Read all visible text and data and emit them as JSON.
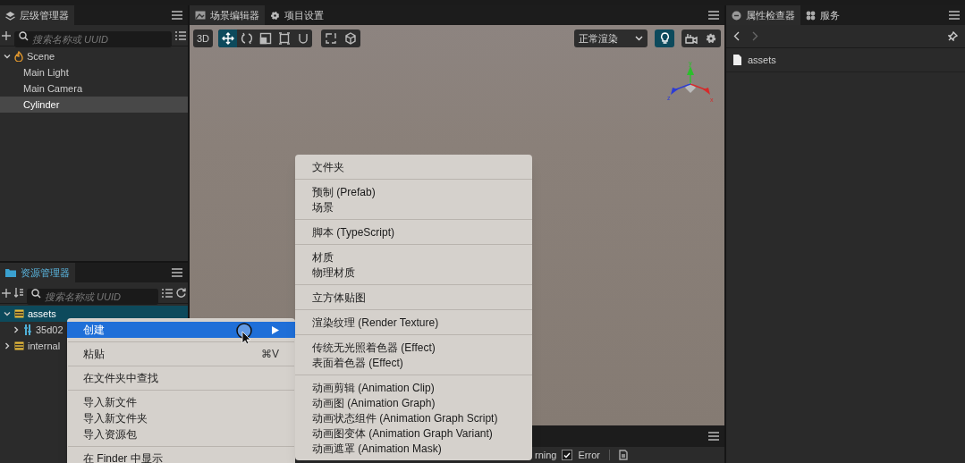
{
  "hierarchy": {
    "tab": "层级管理器",
    "search": {
      "placeholder": "搜索名称或 UUID"
    },
    "tree": [
      {
        "label": "Scene",
        "kind": "scene",
        "expanded": true,
        "selected": false,
        "children": [
          {
            "label": "Main Light",
            "selected": false
          },
          {
            "label": "Main Camera",
            "selected": false
          },
          {
            "label": "Cylinder",
            "selected": true
          }
        ]
      }
    ]
  },
  "scene_editor": {
    "tabs": [
      {
        "label": "场景编辑器",
        "kind": "image",
        "selected": true
      },
      {
        "label": "项目设置",
        "kind": "gear",
        "selected": false
      }
    ],
    "mode_button": "3D",
    "tools": [
      {
        "kind": "move",
        "selected": true
      },
      {
        "kind": "rotate",
        "selected": false
      },
      {
        "kind": "scale",
        "selected": false
      },
      {
        "kind": "rect",
        "selected": false
      },
      {
        "kind": "snap",
        "selected": false
      }
    ],
    "render_mode": "正常渲染",
    "light_on": true,
    "gizmo_axes": [
      "y",
      "x",
      "z"
    ]
  },
  "console": {
    "filters": [
      {
        "label": "rning"
      },
      {
        "label": "Error",
        "checked": true
      }
    ]
  },
  "assets": {
    "tab": "资源管理器",
    "search": {
      "placeholder": "搜索名称或 UUID"
    },
    "tree": [
      {
        "label": "assets",
        "kind": "folder",
        "expanded": true,
        "selected": true,
        "children": [
          {
            "label": "35d02",
            "kind": "bundle",
            "expanded": false,
            "selected": false
          }
        ]
      },
      {
        "label": "internal",
        "kind": "folder",
        "expanded": false,
        "selected": false
      }
    ]
  },
  "inspector": {
    "tabs": [
      {
        "label": "属性检查器",
        "kind": "inspector",
        "selected": true
      },
      {
        "label": "服务",
        "kind": "services",
        "selected": false
      }
    ],
    "item": "assets"
  },
  "context_menu": {
    "groups": [
      [
        {
          "label": "创建",
          "selected": true,
          "submenu": true
        }
      ],
      [
        {
          "label": "粘贴",
          "shortcut": "⌘V",
          "selected": false
        }
      ],
      [
        {
          "label": "在文件夹中查找",
          "selected": false
        }
      ],
      [
        {
          "label": "导入新文件",
          "selected": false
        },
        {
          "label": "导入新文件夹",
          "selected": false
        },
        {
          "label": "导入资源包",
          "selected": false
        }
      ],
      [
        {
          "label": "在 Finder 中显示",
          "selected": false
        }
      ]
    ]
  },
  "submenu": {
    "groups": [
      [
        "文件夹"
      ],
      [
        "预制 (Prefab)",
        "场景"
      ],
      [
        "脚本 (TypeScript)"
      ],
      [
        "材质",
        "物理材质"
      ],
      [
        "立方体贴图"
      ],
      [
        "渲染纹理 (Render Texture)"
      ],
      [
        "传统无光照着色器 (Effect)",
        "表面着色器 (Effect)"
      ],
      [
        "动画剪辑 (Animation Clip)",
        "动画图 (Animation Graph)",
        "动画状态组件 (Animation Graph Script)",
        "动画图变体 (Animation Graph Variant)",
        "动画遮罩 (Animation Mask)"
      ]
    ]
  }
}
